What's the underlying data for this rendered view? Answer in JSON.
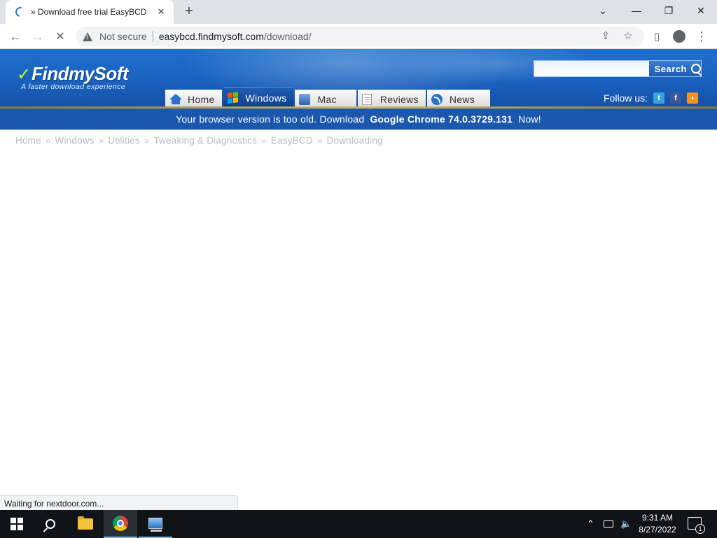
{
  "browser": {
    "tab_title": "» Download free trial EasyBCD",
    "tab_close": "✕",
    "new_tab": "+",
    "window_controls": {
      "minimize": "—",
      "maximize": "❐",
      "close": "✕",
      "tab_search": "⌄"
    },
    "nav": {
      "back": "←",
      "forward": "→",
      "stop": "✕"
    },
    "security_label": "Not secure",
    "url_domain": "easybcd.findmysoft.com",
    "url_path": "/download/",
    "toolbar_icons": [
      "share-icon",
      "star-icon",
      "side-panel-icon",
      "profile-icon",
      "menu-icon"
    ]
  },
  "site": {
    "logo_text": "FindmySoft",
    "tagline": "A faster download experience",
    "search": {
      "placeholder": "",
      "button_label": "Search"
    },
    "nav": [
      {
        "label": "Home",
        "icon": "home-icon"
      },
      {
        "label": "Windows",
        "icon": "windows-icon",
        "active": true
      },
      {
        "label": "Mac",
        "icon": "mac-icon"
      },
      {
        "label": "Reviews",
        "icon": "reviews-icon"
      },
      {
        "label": "News",
        "icon": "news-icon"
      }
    ],
    "follow_label": "Follow us:",
    "social": [
      {
        "name": "twitter-icon",
        "glyph": "t",
        "color": "#38a1e0"
      },
      {
        "name": "facebook-icon",
        "glyph": "f",
        "color": "#3b5998"
      },
      {
        "name": "rss-icon",
        "glyph": "◗",
        "color": "#f7931e"
      }
    ],
    "notice": {
      "prefix": "Your browser version is too old. Download",
      "product": "Google Chrome 74.0.3729.131",
      "suffix": "Now!"
    },
    "breadcrumb": [
      "Home",
      "Windows",
      "Utilities",
      "Tweaking & Diagnostics",
      "EasyBCD",
      "Downloading"
    ],
    "breadcrumb_separator": "»"
  },
  "status_text": "Waiting for nextdoor.com...",
  "taskbar": {
    "clock_time": "9:31 AM",
    "clock_date": "8/27/2022",
    "notification_count": "1",
    "tray_chevron": "⌃"
  },
  "colors": {
    "header_blue": "#1a61be",
    "notice_blue": "#1b57ad",
    "active_tab": "#1f5fb7",
    "taskbar": "#101418"
  }
}
